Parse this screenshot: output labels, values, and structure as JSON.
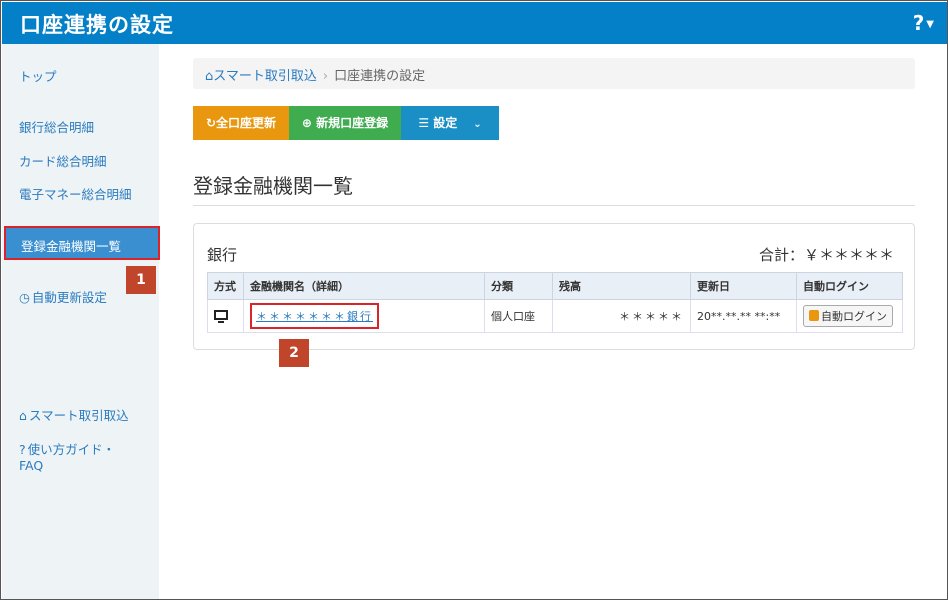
{
  "header": {
    "title": "口座連携の設定",
    "help_label": "?"
  },
  "sidebar": {
    "items": [
      {
        "label": "トップ"
      },
      {
        "label": "銀行総合明細"
      },
      {
        "label": "カード総合明細"
      },
      {
        "label": "電子マネー総合明細"
      },
      {
        "label": "登録金融機関一覧"
      },
      {
        "label": "自動更新設定"
      },
      {
        "label": "スマート取引取込"
      },
      {
        "label": "使い方ガイド・"
      },
      {
        "label": "FAQ"
      }
    ]
  },
  "badges": {
    "one": "1",
    "two": "2"
  },
  "breadcrumb": {
    "home": "スマート取引取込",
    "current": "口座連携の設定"
  },
  "toolbar": {
    "update_all": "全口座更新",
    "new_account": "新規口座登録",
    "settings": "設定"
  },
  "page_title": "登録金融機関一覧",
  "panel": {
    "title": "銀行",
    "total": "合計：￥＊＊＊＊＊",
    "columns": [
      "方式",
      "金融機関名（詳細）",
      "分類",
      "残高",
      "更新日",
      "自動ログイン"
    ],
    "rows": [
      {
        "name": "＊＊＊＊＊＊＊銀行",
        "type": "個人口座",
        "balance": "＊＊＊＊＊",
        "updated": "20**.**.** **:**",
        "login": "自動ログイン"
      }
    ]
  },
  "colors": {
    "header": "#0480c8",
    "active": "#3a8fd0",
    "orange": "#e8970e",
    "green": "#3fac50",
    "blue": "#1a8fc6",
    "highlight": "#d9252a",
    "badge": "#c0452a"
  }
}
